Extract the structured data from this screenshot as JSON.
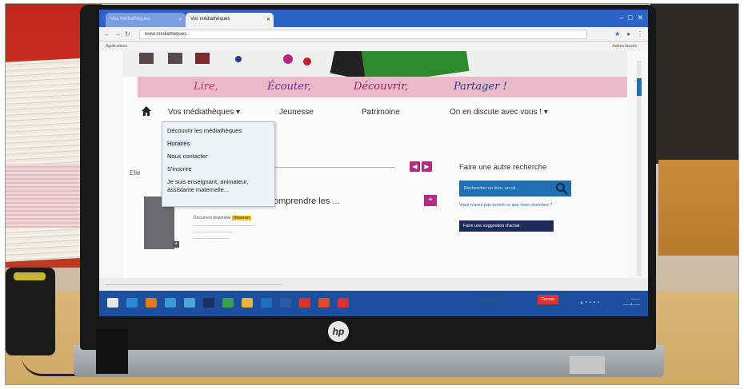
{
  "browser": {
    "tab_1": "Vos médiathèques",
    "tab_2": "Vos médiathèques",
    "address": "www.mediatheques...",
    "bookmarks_left": "Applications",
    "bookmarks_right": "Autres favoris"
  },
  "site": {
    "slogan": [
      "Lire,",
      "Écouter,",
      "Découvrir,",
      "Partager !"
    ],
    "menu": [
      "Vos médiathèques ▾",
      "Jeunesse",
      "Patrimoine",
      "On en discute avec vous ! ▾"
    ],
    "dropdown": [
      "Découvrir les médiathèques",
      "Horaires",
      "Nous contacter",
      "S'inscrire",
      "Je suis enseignant, animateur,",
      "assistante maternelle..."
    ],
    "result_title": "omprendre les ...",
    "availability": "Document disponible",
    "badge": "Réserver",
    "side": {
      "title": "Faire une autre recherche",
      "search_placeholder": "Rechercher un livre, un cd...",
      "help": "Vous n'avez pas trouvé ce que vous cherchez ?",
      "button": "Faire une suggestion d'achat"
    }
  },
  "cookie": {
    "link": "En savoir plus",
    "button": "Fermer"
  },
  "laptop": {
    "logo": "hp"
  },
  "colors": {
    "menu_accent": "#b22a82",
    "slogan_bg": "#e7b9c9",
    "search_blue": "#1f6fb2",
    "taskbar": "#1c4f9e"
  }
}
